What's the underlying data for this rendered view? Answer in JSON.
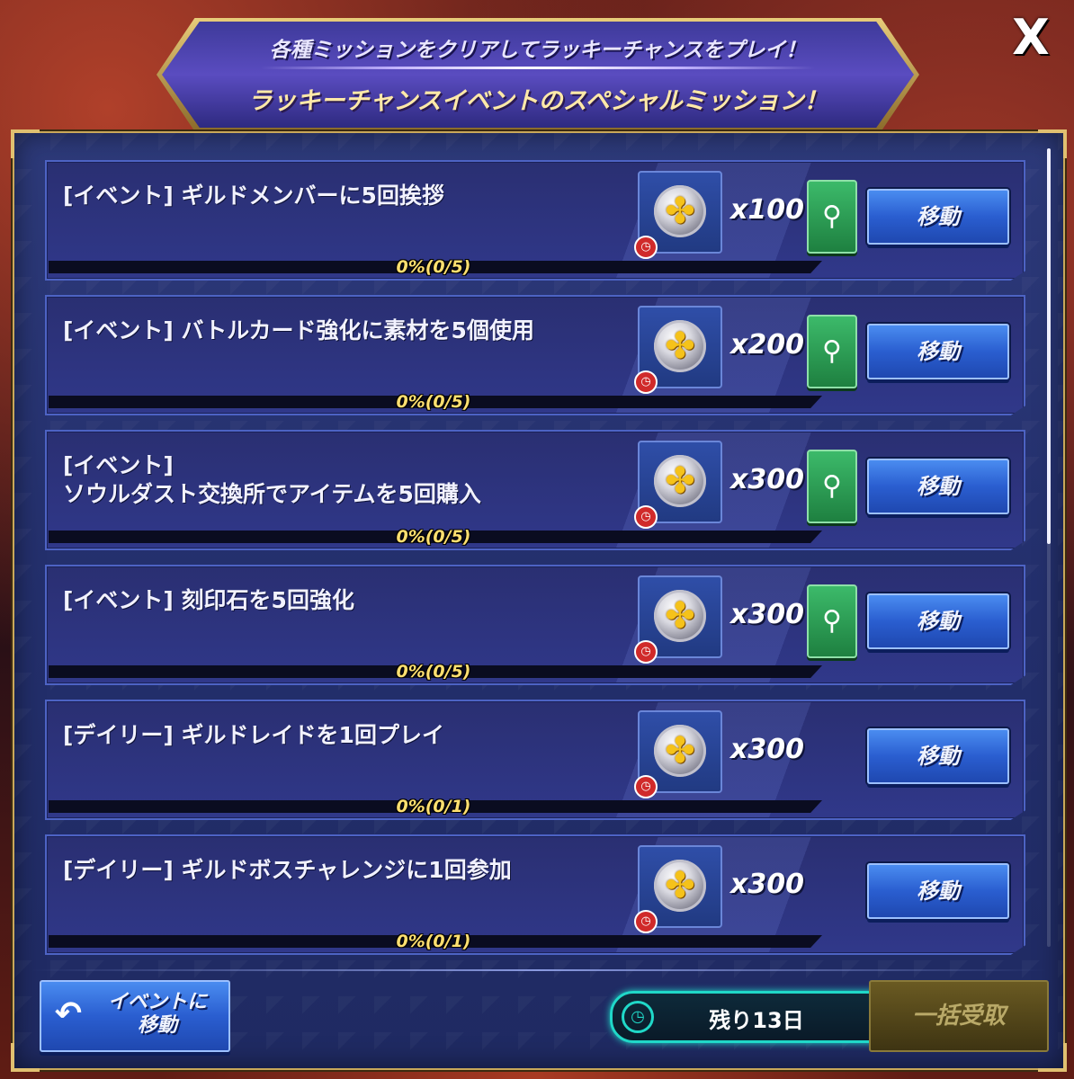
{
  "header": {
    "subtitle": "各種ミッションをクリアしてラッキーチャンスをプレイ！",
    "title": "ラッキーチャンスイベントのスペシャルミッション！",
    "close_label": "X"
  },
  "missions": [
    {
      "text": "[イベント] ギルドメンバーに5回挨拶",
      "progress": "0%(0/5)",
      "progress_fraction": 0,
      "reward_qty": "x100",
      "has_search": true,
      "move_label": "移動"
    },
    {
      "text": "[イベント] バトルカード強化に素材を5個使用",
      "progress": "0%(0/5)",
      "progress_fraction": 0,
      "reward_qty": "x200",
      "has_search": true,
      "move_label": "移動"
    },
    {
      "text": "[イベント]\nソウルダスト交換所でアイテムを5回購入",
      "progress": "0%(0/5)",
      "progress_fraction": 0,
      "reward_qty": "x300",
      "has_search": true,
      "move_label": "移動"
    },
    {
      "text": "[イベント] 刻印石を5回強化",
      "progress": "0%(0/5)",
      "progress_fraction": 0,
      "reward_qty": "x300",
      "has_search": true,
      "move_label": "移動"
    },
    {
      "text": "[デイリー] ギルドレイドを1回プレイ",
      "progress": "0%(0/1)",
      "progress_fraction": 0,
      "reward_qty": "x300",
      "has_search": false,
      "move_label": "移動"
    },
    {
      "text": "[デイリー] ギルドボスチャレンジに1回参加",
      "progress": "0%(0/1)",
      "progress_fraction": 0,
      "reward_qty": "x300",
      "has_search": false,
      "move_label": "移動"
    }
  ],
  "footer": {
    "back_label": "イベントに\n移動",
    "remaining": "残り13日",
    "bulk_label": "一括受取"
  },
  "icons": {
    "reward": "clover-coin-icon",
    "timer": "clock-icon",
    "search": "search-icon",
    "back": "back-arrow-icon"
  },
  "colors": {
    "accent_gold": "#ffe9a8",
    "progress_text": "#ffe070",
    "move_button": "#2a5ed0",
    "search_button": "#1e8040",
    "timer_ring": "#20d8c8"
  }
}
